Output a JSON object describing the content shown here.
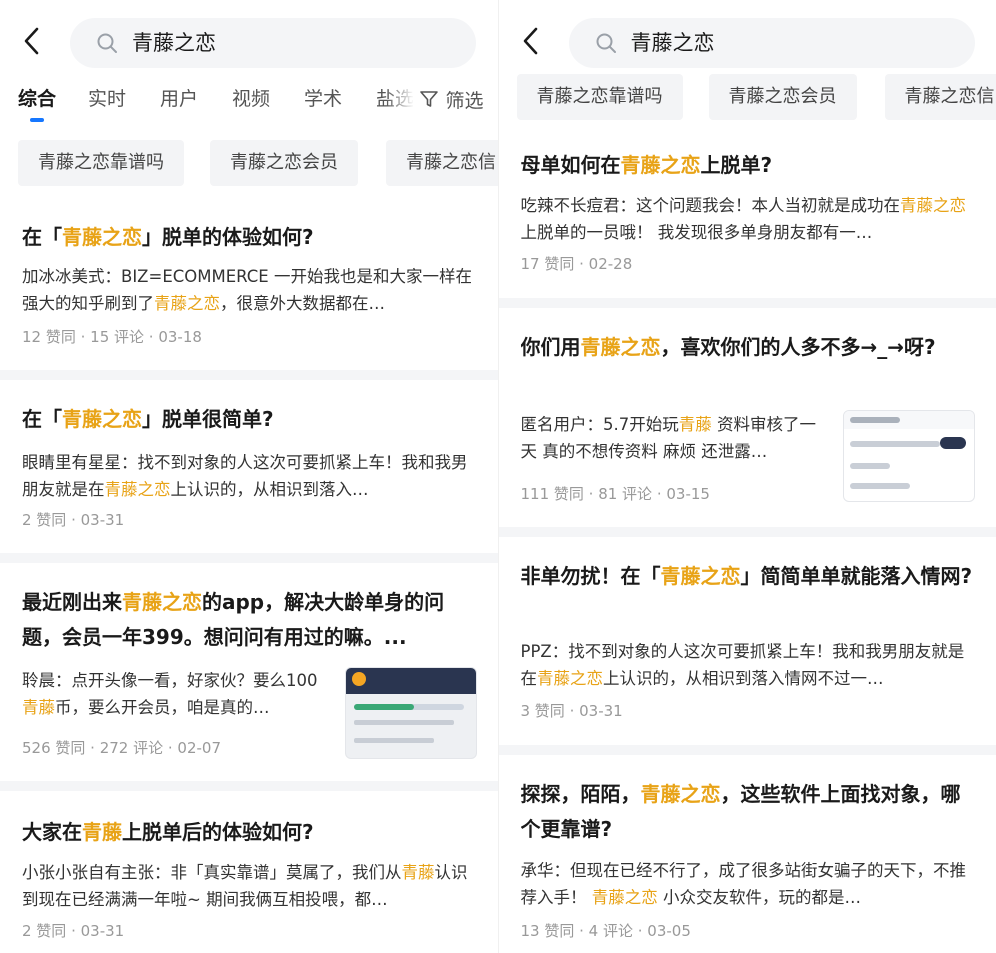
{
  "left": {
    "search_query": "青藤之恋",
    "tabs": [
      "综合",
      "实时",
      "用户",
      "视频",
      "学术",
      "盐选"
    ],
    "filter_label": "筛选",
    "chips": [
      "青藤之恋靠谱吗",
      "青藤之恋会员",
      "青藤之恋信"
    ],
    "cards": [
      {
        "title": [
          "在「",
          "青藤之恋",
          "」脱单的体验如何?"
        ],
        "snippet": [
          "加冰冰美式：BIZ=ECOMMERCE 一开始我也是和大家一样在强大的知乎刷到了",
          "青藤之恋",
          "，很意外大数据都在…"
        ],
        "meta": "12 赞同 · 15 评论 · 03-18"
      },
      {
        "title": [
          "在「",
          "青藤之恋",
          "」脱单很简单?"
        ],
        "snippet": [
          "眼睛里有星星：找不到对象的人这次可要抓紧上车！我和我男朋友就是在",
          "青藤之恋",
          "上认识的，从相识到落入…"
        ],
        "meta": "2 赞同 · 03-31"
      },
      {
        "title": [
          "最近刚出来",
          "青藤之恋",
          "的app，解决大龄单身的问题，会员一年399。想问问有用过的嘛。..."
        ],
        "snippet": [
          "聆晨：点开头像一看，好家伙？要么100",
          "青藤",
          "币，要么开会员，咱是真的…"
        ],
        "meta": "526 赞同 · 272 评论 · 02-07"
      },
      {
        "title": [
          "大家在",
          "青藤",
          "上脱单后的体验如何?"
        ],
        "snippet": [
          "小张小张自有主张：非「真实靠谱」莫属了，我们从",
          "青藤",
          "认识到现在已经满满一年啦~ 期间我俩互相投喂，都…"
        ],
        "meta": "2 赞同 · 03-31"
      }
    ]
  },
  "right": {
    "search_query": "青藤之恋",
    "chips": [
      "青藤之恋靠谱吗",
      "青藤之恋会员",
      "青藤之恋信"
    ],
    "cards": [
      {
        "title": [
          "母单如何在",
          "青藤之恋",
          "上脱单?"
        ],
        "snippet": [
          "吃辣不长痘君：这个问题我会！本人当初就是成功在",
          "青藤之恋",
          "上脱单的一员哦！ 我发现很多单身朋友都有一…"
        ],
        "meta": "17 赞同 · 02-28"
      },
      {
        "title": [
          "你们用",
          "青藤之恋",
          "，喜欢你们的人多不多→_→呀?"
        ],
        "snippet": [
          "匿名用户：5.7开始玩",
          "青藤",
          " 资料审核了一天 真的不想传资料 麻烦 还泄露…"
        ],
        "meta": "111 赞同 · 81 评论 · 03-15"
      },
      {
        "title": [
          "非单勿扰！在「",
          "青藤之恋",
          "」简简单单就能落入情网?"
        ],
        "snippet": [
          "PPZ：找不到对象的人这次可要抓紧上车！我和我男朋友就是在",
          "青藤之恋",
          "上认识的，从相识到落入情网不过一…"
        ],
        "meta": "3 赞同 · 03-31"
      },
      {
        "title": [
          "探探，陌陌，",
          "青藤之恋",
          "，这些软件上面找对象，哪个更靠谱?"
        ],
        "snippet": [
          "承华：但现在已经不行了，成了很多站街女骗子的天下，不推荐入手！ ",
          "青藤之恋",
          " 小众交友软件，玩的都是…"
        ],
        "meta": "13 赞同 · 4 评论 · 03-05"
      }
    ]
  },
  "colors": {
    "highlight": "#e8a317",
    "tab_indicator": "#1677ff",
    "muted": "#999999"
  },
  "icons": {
    "back": "chevron-left-icon",
    "search": "search-icon",
    "filter": "filter-funnel-icon"
  }
}
